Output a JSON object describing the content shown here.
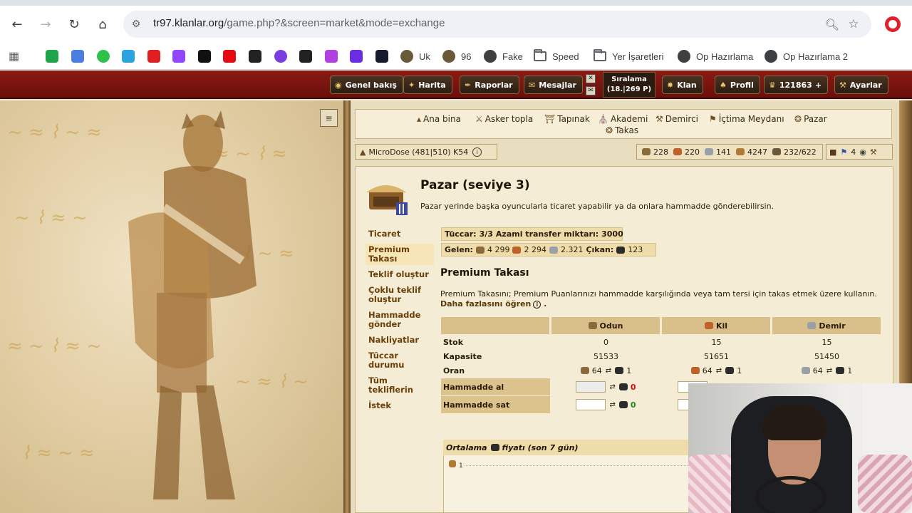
{
  "browser": {
    "url_host": "tr97.klanlar.org",
    "url_path": "/game.php?&screen=market&mode=exchange",
    "bookmarks": [
      {
        "label": "",
        "icon": "rk-icon",
        "color": "#1fa44a"
      },
      {
        "label": "",
        "icon": "translate-icon",
        "color": "#4a7fe0"
      },
      {
        "label": "",
        "icon": "green-circle-icon",
        "color": "#2ec24b"
      },
      {
        "label": "",
        "icon": "telegram-icon",
        "color": "#2aa3e0"
      },
      {
        "label": "",
        "icon": "youtube-icon",
        "color": "#e02020"
      },
      {
        "label": "",
        "icon": "twitch-icon",
        "color": "#9146ff"
      },
      {
        "label": "",
        "icon": "kick-icon",
        "color": "#111111"
      },
      {
        "label": "",
        "icon": "netflix-icon",
        "color": "#e50914"
      },
      {
        "label": "",
        "icon": "notion-icon",
        "color": "#222222"
      },
      {
        "label": "",
        "icon": "purple-circle-icon",
        "color": "#7a3ee0"
      },
      {
        "label": "",
        "icon": "bird-icon",
        "color": "#222222"
      },
      {
        "label": "",
        "icon": "c-icon",
        "color": "#b040e0"
      },
      {
        "label": "",
        "icon": "play-icon",
        "color": "#6a2de0"
      },
      {
        "label": "",
        "icon": "crown-icon",
        "color": "#1a1a2e"
      },
      {
        "label": "Uk",
        "icon": "knight-icon",
        "color": "#6a5a3a"
      },
      {
        "label": "96",
        "icon": "knight-icon",
        "color": "#6a5a3a"
      },
      {
        "label": "Fake",
        "icon": "globe-icon",
        "color": "#3c4043"
      },
      {
        "label": "Speed",
        "icon": "folder-icon",
        "color": "#3c4043"
      },
      {
        "label": "Yer İşaretleri",
        "icon": "folder-icon",
        "color": "#3c4043"
      },
      {
        "label": "Op Hazırlama",
        "icon": "globe-icon",
        "color": "#3c4043"
      },
      {
        "label": "Op Hazırlama 2",
        "icon": "globe-icon",
        "color": "#3c4043"
      }
    ]
  },
  "topbar": {
    "overview": "Genel bakış",
    "map": "Harita",
    "reports": "Raporlar",
    "messages": "Mesajlar",
    "rank_label": "Sıralama",
    "rank_value": "(18.|269 P)",
    "clan": "Klan",
    "profile": "Profil",
    "points": "121863",
    "settings": "Ayarlar"
  },
  "buildings": {
    "main": "Ana bina",
    "barracks": "Asker topla",
    "temple": "Tapınak",
    "academy": "Akademi",
    "smith": "Demirci",
    "rally": "İçtima Meydanı",
    "market": "Pazar",
    "exchange": "Takas"
  },
  "village": {
    "name": "MicroDose (481|510) K54"
  },
  "resources": {
    "wood": "228",
    "clay": "220",
    "iron": "141",
    "storage": "4247",
    "pop": "232/622",
    "incoming": "4"
  },
  "page": {
    "title": "Pazar (seviye 3)",
    "description": "Pazar yerinde başka oyuncularla ticaret yapabilir ya da onlara hammadde gönderebilirsin."
  },
  "submenu": [
    {
      "label": "Ticaret",
      "active": false
    },
    {
      "label": "Premium Takası",
      "active": true
    },
    {
      "label": "Teklif oluştur",
      "active": false
    },
    {
      "label": "Çoklu teklif oluştur",
      "active": false
    },
    {
      "label": "Hammadde gönder",
      "active": false
    },
    {
      "label": "Nakliyatlar",
      "active": false
    },
    {
      "label": "Tüccar durumu",
      "active": false
    },
    {
      "label": "Tüm tekliflerin",
      "active": false
    },
    {
      "label": "İstek",
      "active": false
    }
  ],
  "merchants": {
    "label": "Tüccar:",
    "value": "3/3",
    "max_label": "Azami transfer miktarı:",
    "max_value": "3000"
  },
  "transfers": {
    "incoming_label": "Gelen:",
    "in_wood": "4 299",
    "in_clay": "2 294",
    "in_iron": "2.321",
    "outgoing_label": "Çıkan:",
    "out_value": "123"
  },
  "section": {
    "title": "Premium Takası",
    "description": "Premium Takasını; Premium Puanlarınızı hammadde karşılığında veya tam tersi için takas etmek üzere kullanın.",
    "more": "Daha fazlasını öğren"
  },
  "exchange": {
    "headers": [
      "",
      "Odun",
      "Kil",
      "Demir"
    ],
    "stock_label": "Stok",
    "stock": [
      "0",
      "15",
      "15"
    ],
    "capacity_label": "Kapasite",
    "capacity": [
      "51533",
      "51651",
      "51450"
    ],
    "rate_label": "Oran",
    "rate_res": [
      "64",
      "64",
      "64"
    ],
    "rate_pp": [
      "1",
      "1",
      "1"
    ],
    "buy_label": "Hammadde al",
    "buy_value": "0",
    "sell_label": "Hammadde sat",
    "sell_value": "0"
  },
  "average": {
    "title": "Ortalama",
    "title_suffix": "fiyatı (son 7 gün)",
    "y_tick": "1"
  },
  "colors": {
    "wood": "#8a6a3a",
    "clay": "#c0602a",
    "iron": "#9aa0a8",
    "premium": "#2c2c2c"
  }
}
